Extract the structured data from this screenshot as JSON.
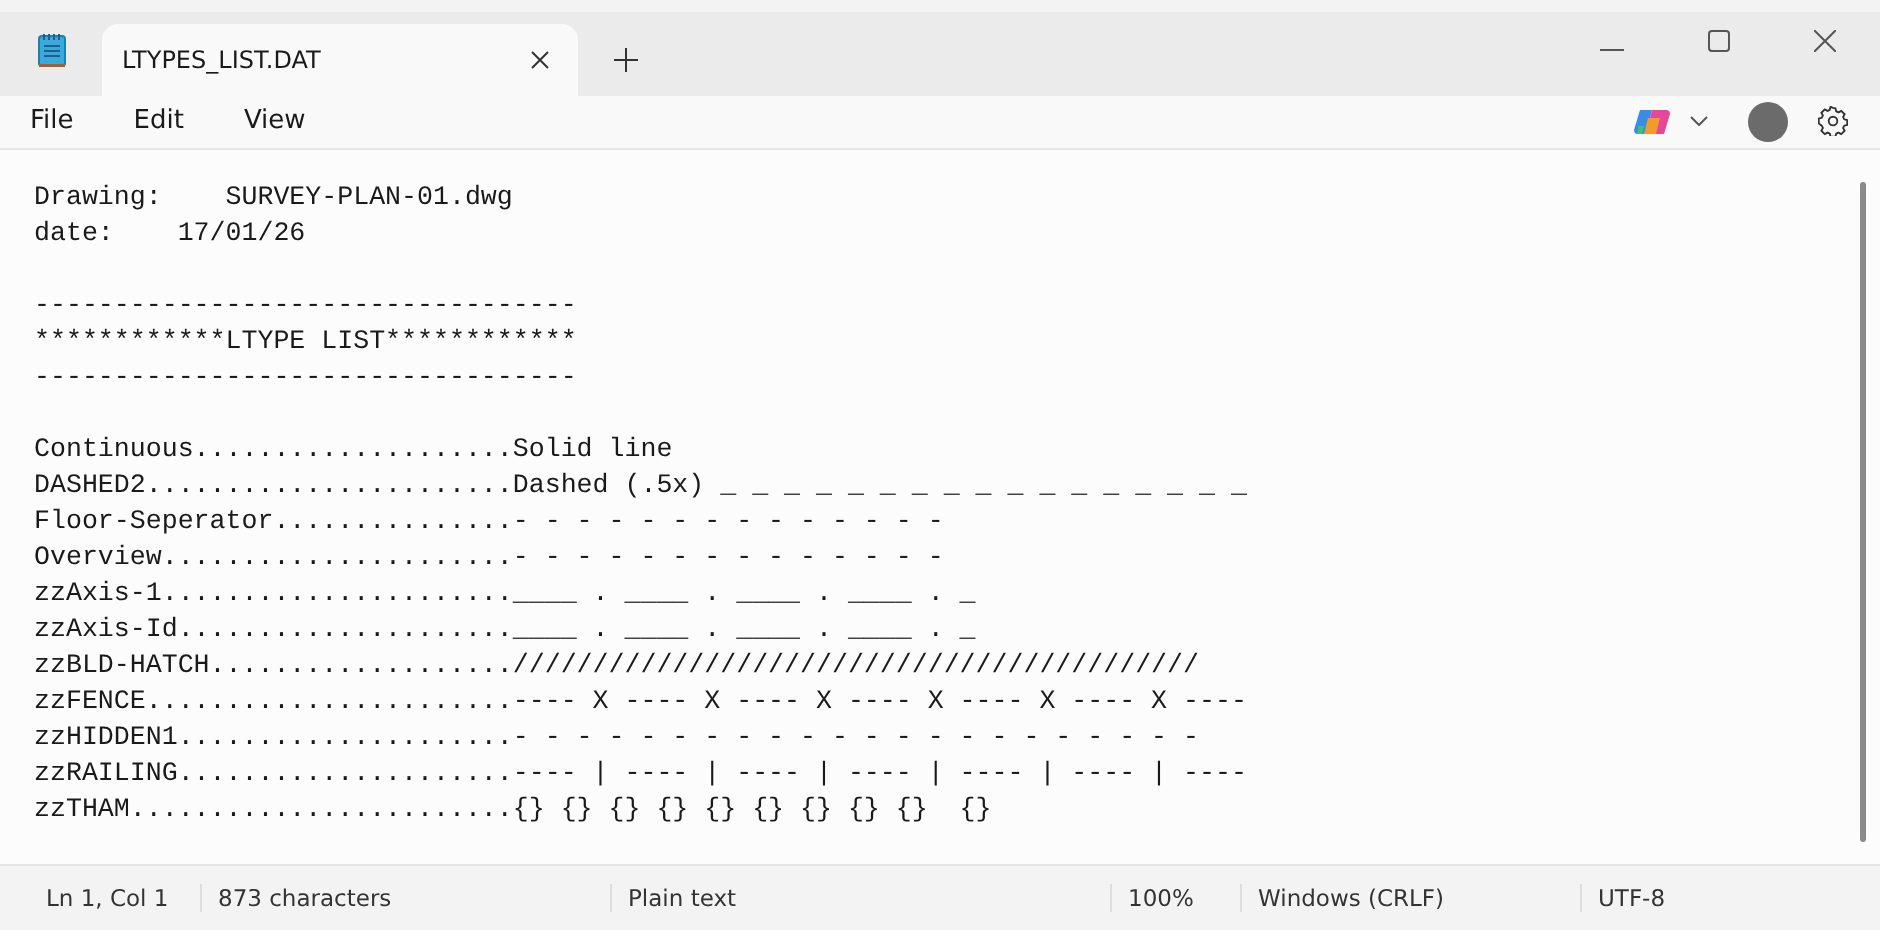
{
  "tabs": [
    {
      "label": "LTYPES_LIST.DAT",
      "selected": true
    }
  ],
  "menu": [
    "File",
    "Edit",
    "View"
  ],
  "document": {
    "sections": [
      [
        "Drawing:    SURVEY-PLAN-01.dwg",
        "date:    17/01/26"
      ],
      [
        "----------------------------------",
        "************LTYPE LIST************",
        "----------------------------------"
      ],
      [
        "Continuous....................Solid line",
        "DASHED2.......................Dashed (.5x) _ _ _ _ _ _ _ _ _ _ _ _ _ _ _ _ _",
        "Floor-Seperator...............- - - - - - - - - - - - - -",
        "Overview......................- - - - - - - - - - - - - -",
        "zzAxis-1......................____ . ____ . ____ . ____ . _",
        "zzAxis-Id.....................____ . ____ . ____ . ____ . _",
        "zzBLD-HATCH...................///////////////////////////////////////////",
        "zzFENCE.......................---- X ---- X ---- X ---- X ---- X ---- X ----",
        "zzHIDDEN1.....................- - - - - - - - - - - - - - - - - - - - - -",
        "zzRAILING.....................---- | ---- | ---- | ---- | ---- | ---- | ----",
        "zzTHAM........................{} {} {} {} {} {} {} {} {}  {}"
      ]
    ]
  },
  "status_bar": [
    "Ln 1, Col 1",
    "873 characters",
    "Plain text",
    "100%",
    "Windows (CRLF)",
    "UTF-8"
  ]
}
